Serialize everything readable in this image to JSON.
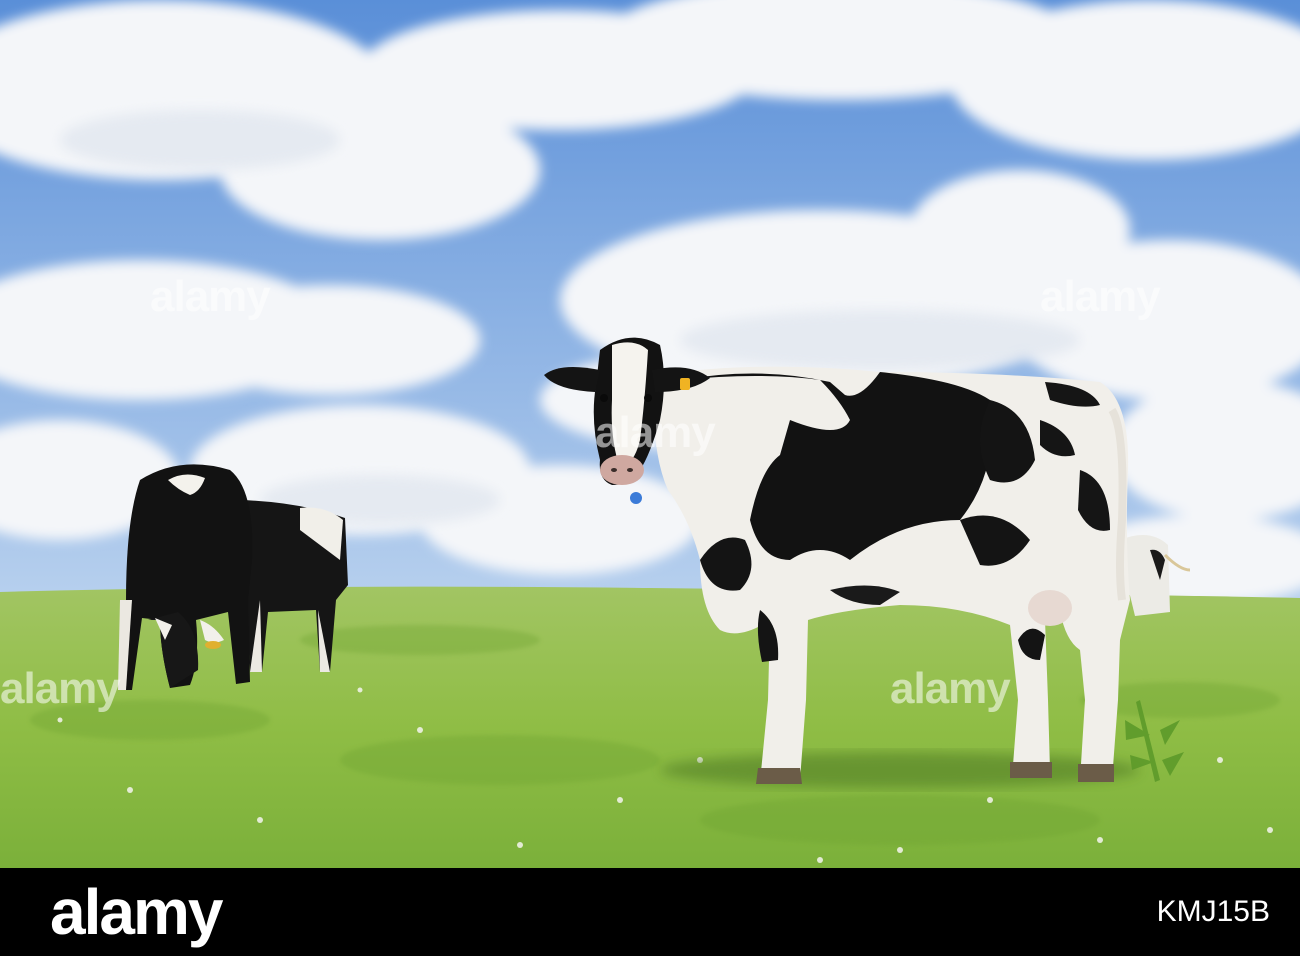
{
  "watermark": {
    "text": "alamy"
  },
  "footer": {
    "logo_text": "alamy",
    "image_id": "KMJ15B"
  },
  "colors": {
    "sky_top": "#4f86d4",
    "sky_bottom": "#bcd4f0",
    "grass_top": "#9cc35a",
    "grass_bottom": "#7eb33a",
    "cow_black": "#141414",
    "cow_white": "#f2f0ec",
    "footer_bg": "#000000"
  }
}
